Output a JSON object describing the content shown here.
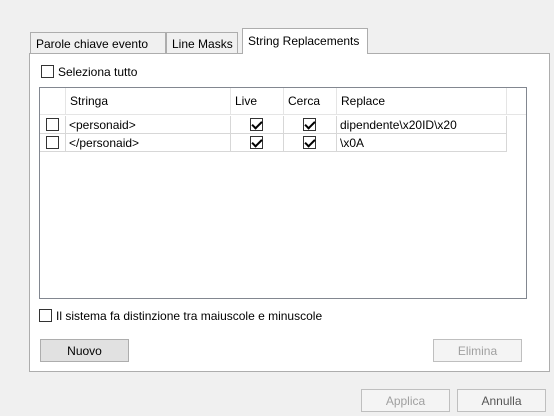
{
  "tabs": [
    {
      "label": "Parole chiave evento"
    },
    {
      "label": "Line Masks"
    },
    {
      "label": "String Replacements"
    }
  ],
  "select_all": {
    "label": "Seleziona tutto",
    "checked": false
  },
  "grid": {
    "headers": [
      "",
      "Stringa",
      "Live",
      "Cerca",
      "Replace"
    ],
    "rows": [
      {
        "selected": false,
        "stringa": "<personaid>",
        "live": true,
        "cerca": true,
        "replace": "dipendente\\x20ID\\x20"
      },
      {
        "selected": false,
        "stringa": "</personaid>",
        "live": true,
        "cerca": true,
        "replace": "\\x0A"
      }
    ]
  },
  "case_sensitive": {
    "label": "Il sistema fa distinzione tra maiuscole e minuscole",
    "checked": false
  },
  "buttons": {
    "new": "Nuovo",
    "delete": "Elimina",
    "apply": "Applica",
    "cancel": "Annulla"
  }
}
